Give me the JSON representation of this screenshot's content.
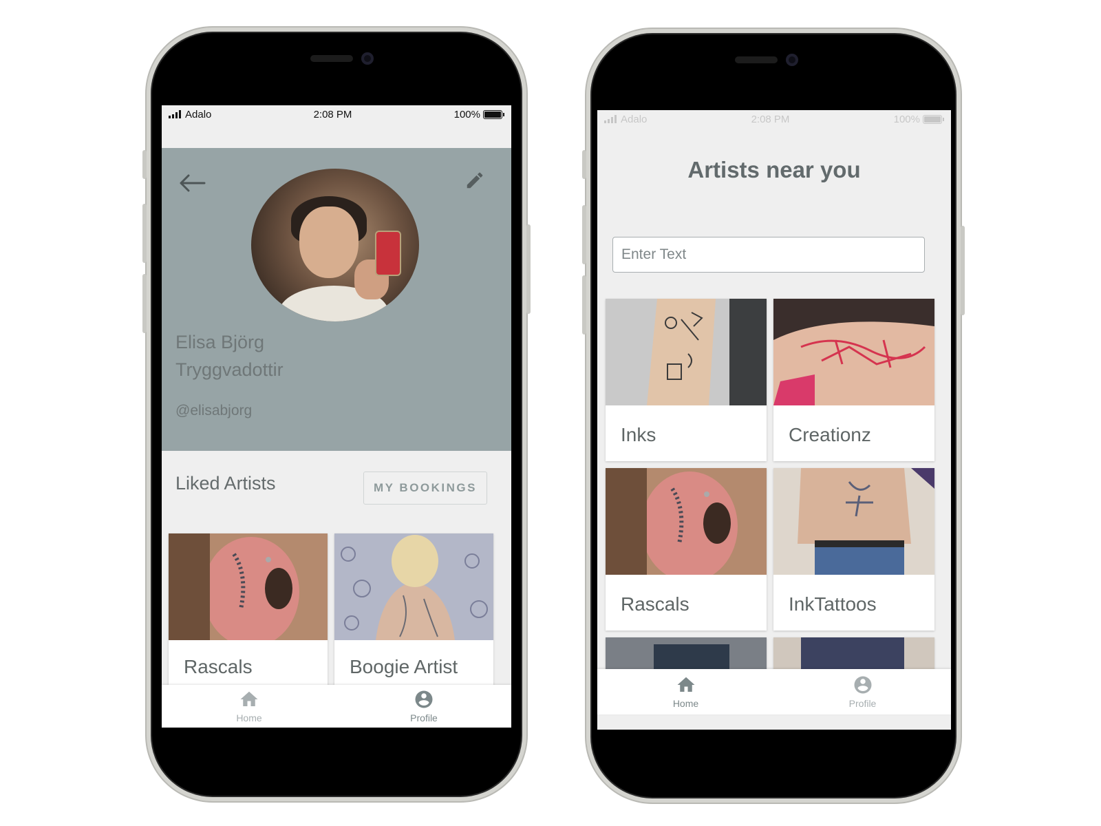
{
  "left_phone": {
    "status_bar": {
      "carrier": "Adalo",
      "time": "2:08 PM",
      "battery": "100%"
    },
    "profile": {
      "name_line1": "Elisa Björg",
      "name_line2": "Tryggvadottir",
      "handle": "@elisabjorg"
    },
    "liked_section": {
      "title": "Liked Artists",
      "bookings_button": "MY BOOKINGS",
      "cards": [
        {
          "label": "Rascals"
        },
        {
          "label": "Boogie Artist"
        }
      ]
    },
    "tabbar": {
      "home_label": "Home",
      "profile_label": "Profile",
      "active": "Profile"
    }
  },
  "right_phone": {
    "status_bar": {
      "carrier": "Adalo",
      "time": "2:08 PM",
      "battery": "100%"
    },
    "title": "Artists near you",
    "search": {
      "placeholder": "Enter Text",
      "value": ""
    },
    "cards": [
      {
        "label": "Inks"
      },
      {
        "label": "Creationz"
      },
      {
        "label": "Rascals"
      },
      {
        "label": "InkTattoos"
      }
    ],
    "tabbar": {
      "home_label": "Home",
      "profile_label": "Profile",
      "active": "Home"
    }
  },
  "colors": {
    "header_bg": "#97a4a6",
    "screen_bg": "#efefef",
    "text_muted": "#646b6c",
    "icon_active": "#7c888a",
    "icon_inactive": "#a7aeb0"
  }
}
